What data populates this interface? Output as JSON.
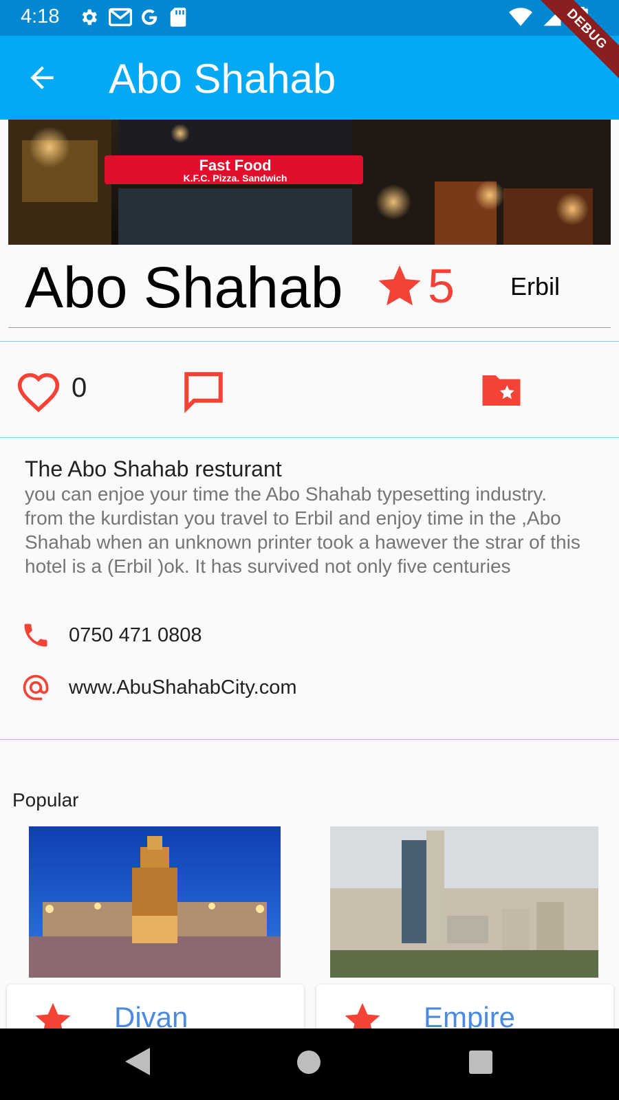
{
  "status_bar": {
    "time": "4:18",
    "left_icons": [
      "settings-icon",
      "gmail-icon",
      "google-icon",
      "sd-card-icon"
    ],
    "right_icons": [
      "wifi-icon",
      "signal-icon",
      "battery-icon"
    ],
    "debug_banner": "DEBUG"
  },
  "app_bar": {
    "title": "Abo Shahab",
    "back_icon": "arrow-back-icon",
    "color": "#03a9f4"
  },
  "hero": {
    "sign_text_1": "Fast Food",
    "sign_text_2": "K.F.C. Pizza. Sandwich"
  },
  "place": {
    "name": "Abo Shahab",
    "rating": "5",
    "city": "Erbil"
  },
  "actions": {
    "like_count": "0",
    "icons": [
      "heart-outline-icon",
      "comment-icon",
      "folder-star-icon"
    ]
  },
  "description": {
    "title": "The Abo Shahab resturant",
    "body": "  you can enjoe your time the Abo Shahab typesetting industry. from the kurdistan you travel to  Erbil  and enjoy time in the ,Abo Shahab when an unknown printer took a hawever the strar of this hotel is a (Erbil )ok. It has survived not only five centuries"
  },
  "contact": {
    "phone": "0750 471 0808",
    "website": "www.AbuShahabCity.com"
  },
  "popular": {
    "label": "Popular",
    "cards": [
      {
        "name": "Divan"
      },
      {
        "name": "Empire"
      }
    ]
  },
  "colors": {
    "accent_red": "#f44336",
    "status_blue": "#0288d1",
    "link_blue": "#4a8ae0"
  }
}
